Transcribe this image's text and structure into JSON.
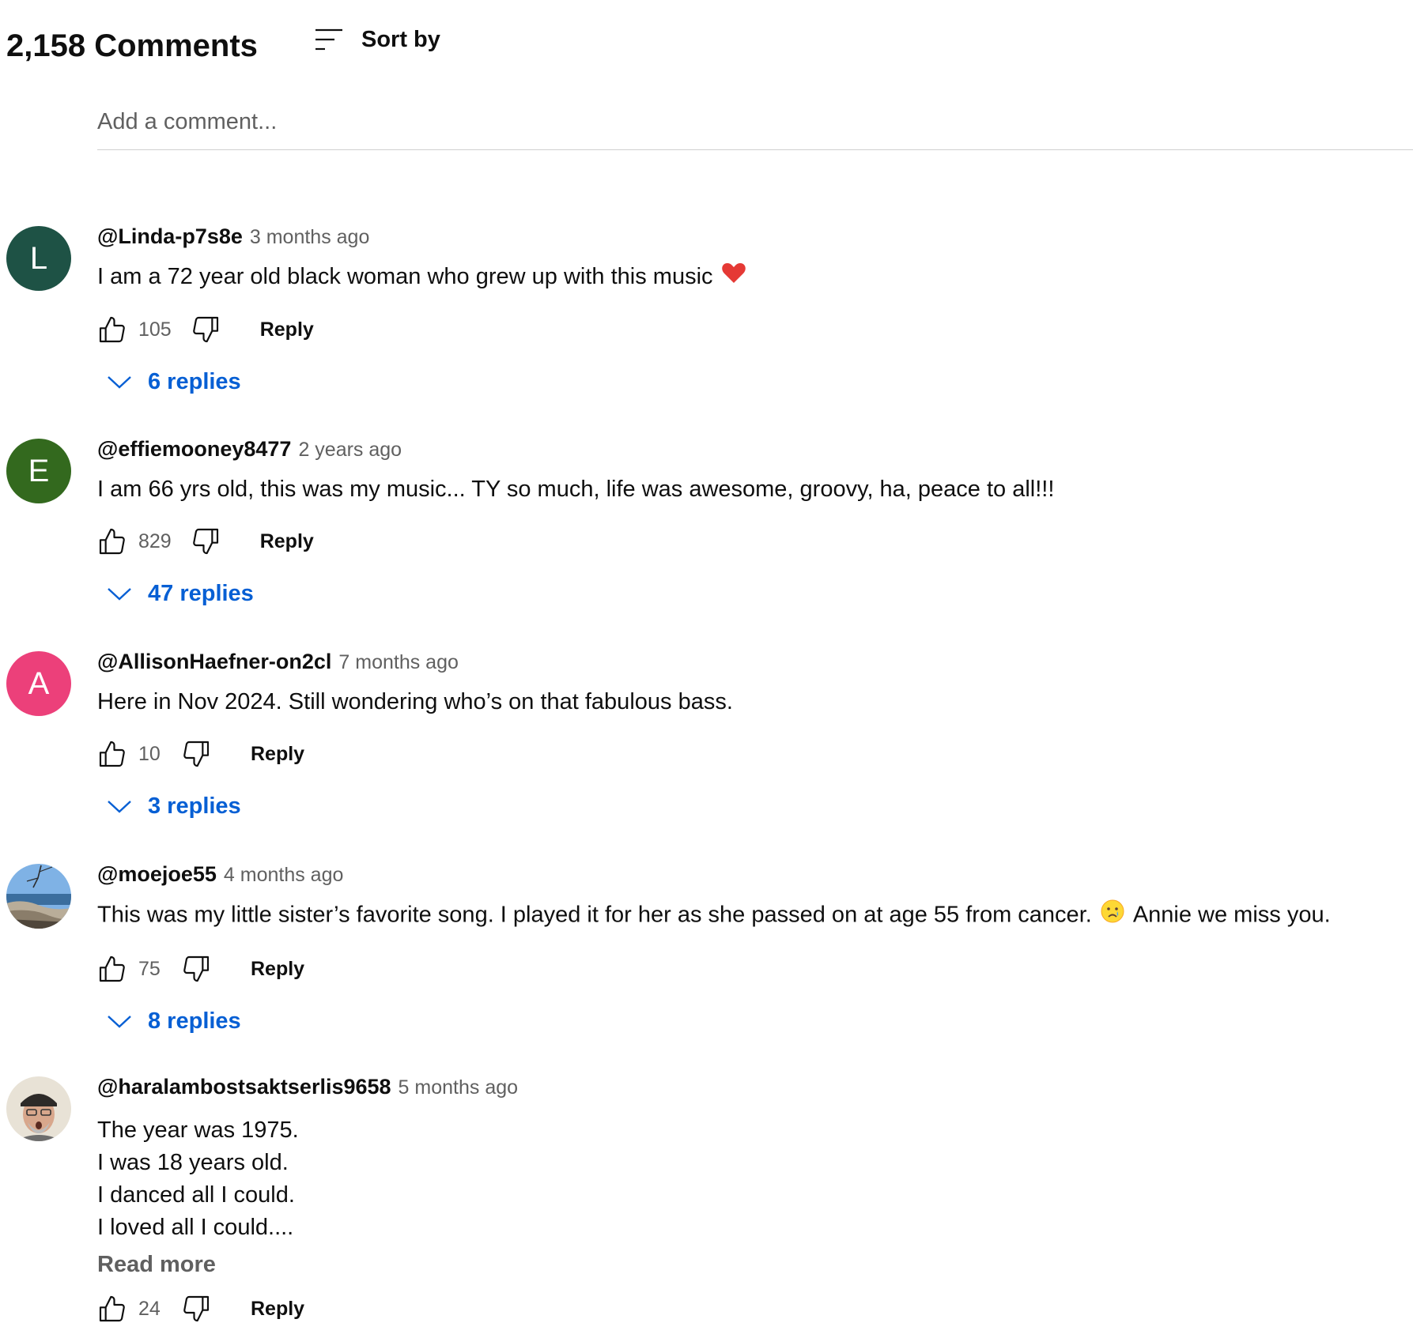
{
  "header": {
    "count_title": "2,158 Comments",
    "sort_label": "Sort by"
  },
  "add_comment": {
    "placeholder": "Add a comment..."
  },
  "colors": {
    "link_blue": "#065fd4",
    "muted": "#606060"
  },
  "comments": [
    {
      "avatar_letter": "L",
      "avatar_color": "#1e5245",
      "author": "@Linda-p7s8e",
      "time": "3 months ago",
      "text": "I am a 72 year old black woman who grew up with this music",
      "emoji": "heart-icon",
      "likes": "105",
      "reply_label": "Reply",
      "replies_label": "6 replies"
    },
    {
      "avatar_letter": "E",
      "avatar_color": "#33691e",
      "author": "@effiemooney8477",
      "time": "2 years ago",
      "text": "I am 66 yrs old, this was my music... TY so much, life was awesome, groovy, ha, peace to all!!!",
      "likes": "829",
      "reply_label": "Reply",
      "replies_label": "47 replies"
    },
    {
      "avatar_letter": "A",
      "avatar_color": "#ec407a",
      "author": "@AllisonHaefner-on2cl",
      "time": "7 months ago",
      "text": "Here in Nov 2024.  Still wondering who’s on that fabulous bass.",
      "likes": "10",
      "reply_label": "Reply",
      "replies_label": "3 replies"
    },
    {
      "author": "@moejoe55",
      "time": "4 months ago",
      "text_before": "This was my little sister’s favorite song. I played it for her as she passed on at age 55 from cancer.",
      "emoji": "crying-face-icon",
      "text_after": "Annie we miss you.",
      "likes": "75",
      "reply_label": "Reply",
      "replies_label": "8 replies"
    },
    {
      "author": "@haralambostsaktserlis9658",
      "time": "5 months ago",
      "lines": [
        "The year was 1975.",
        "I was 18 years old.",
        "I danced all I could.",
        "I loved all I could...."
      ],
      "read_more": "Read more",
      "likes": "24",
      "reply_label": "Reply"
    }
  ]
}
